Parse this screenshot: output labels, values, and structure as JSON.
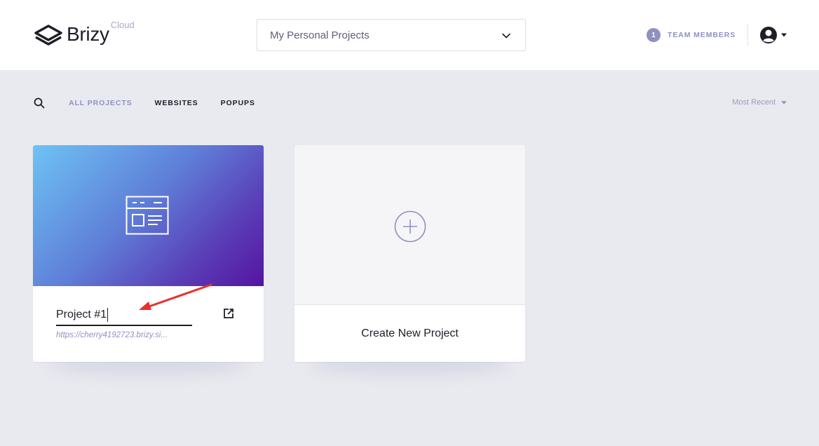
{
  "header": {
    "logo_text": "Brizy",
    "logo_suffix": "Cloud",
    "project_select": {
      "value": "My Personal Projects",
      "icon": "chevron-down-icon"
    },
    "team": {
      "count": "1",
      "label": "TEAM MEMBERS"
    },
    "avatar_icon": "user-avatar-icon"
  },
  "filters": {
    "search_icon": "search-icon",
    "tabs": [
      {
        "label": "ALL PROJECTS",
        "active": true
      },
      {
        "label": "WEBSITES",
        "active": false
      },
      {
        "label": "POPUPS",
        "active": false
      }
    ],
    "sort_label": "Most Recent"
  },
  "projects": [
    {
      "name": "Project #1",
      "url": "https://cherry4192723.brizy.si...",
      "thumb_icon": "webpage-icon",
      "open_icon": "external-link-icon"
    }
  ],
  "create_card": {
    "label": "Create New Project",
    "icon": "plus-circle-icon"
  },
  "annotation": {
    "type": "red-arrow",
    "color": "#e8322b"
  },
  "colors": {
    "accent": "#8f92c0",
    "background": "#e9eaf0",
    "text": "#1d1e28"
  }
}
